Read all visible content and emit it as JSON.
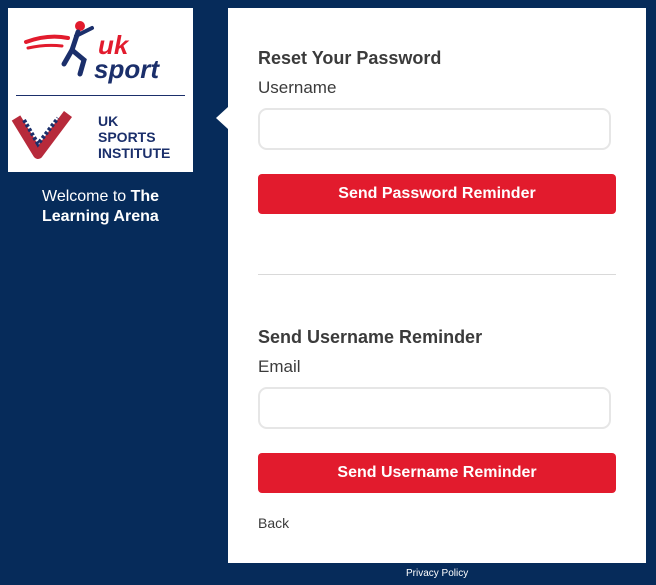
{
  "logos": {
    "uk_sport": "uk sport",
    "institute_line1": "UK",
    "institute_line2": "SPORTS",
    "institute_line3": "INSTITUTE"
  },
  "sidebar": {
    "welcome_prefix": "Welcome to ",
    "welcome_bold": "The Learning Arena"
  },
  "reset_password": {
    "title": "Reset Your Password",
    "field_label": "Username",
    "field_value": "",
    "button_label": "Send Password Reminder"
  },
  "username_reminder": {
    "title": "Send Username Reminder",
    "field_label": "Email",
    "field_value": "",
    "button_label": "Send Username Reminder"
  },
  "links": {
    "back": "Back",
    "privacy": "Privacy Policy"
  },
  "colors": {
    "background": "#062b5a",
    "accent_red": "#e21b2d",
    "brand_navy": "#1b2f6b"
  }
}
